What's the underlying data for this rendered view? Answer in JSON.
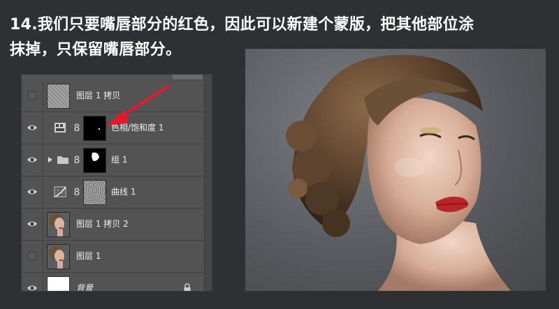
{
  "caption": {
    "line1": "14.我们只要嘴唇部分的红色，因此可以新建个蒙版，把其他部位涂",
    "line2": "抹掉，只保留嘴唇部分。"
  },
  "layers": [
    {
      "name": "图层 1 拷贝",
      "visible": false,
      "thumb": "noise-texture"
    },
    {
      "name": "色相/饱和度 1",
      "visible": true,
      "thumb": "black-mask-dot",
      "adjustment": "hue-saturation"
    },
    {
      "name": "组 1",
      "visible": true,
      "thumb": "black-mask-shape",
      "group": true
    },
    {
      "name": "曲线 1",
      "visible": true,
      "thumb": "noise-mask",
      "adjustment": "curves"
    },
    {
      "name": "图层 1 拷贝 2",
      "visible": true,
      "thumb": "portrait"
    },
    {
      "name": "图层 1",
      "visible": false,
      "thumb": "portrait"
    },
    {
      "name": "背景",
      "visible": true,
      "thumb": "white",
      "locked": true
    }
  ],
  "colors": {
    "page_bg": "#2e3033",
    "panel_bg": "#535353",
    "arrow": "#e8182a",
    "lip": "#b8262c"
  },
  "icons": {
    "eye": "eye-icon",
    "lock": "lock-icon",
    "chain": "link-icon",
    "folder": "folder-icon",
    "disclosure": "triangle-right-icon"
  }
}
